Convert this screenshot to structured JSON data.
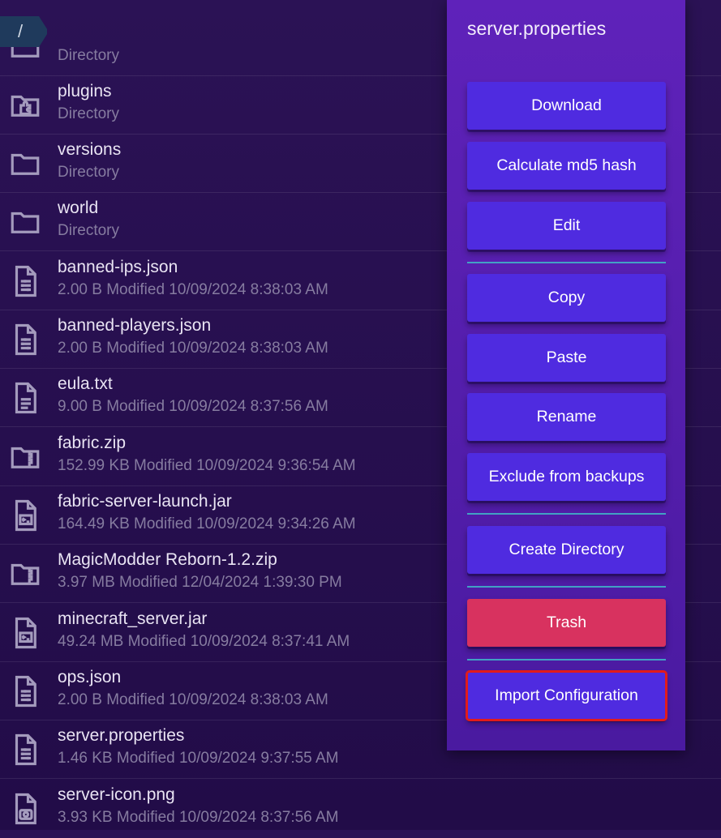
{
  "breadcrumb": {
    "path": "/"
  },
  "files": [
    {
      "name": "",
      "meta": "Directory",
      "icon": "folder-icon"
    },
    {
      "name": "plugins",
      "meta": "Directory",
      "icon": "plugin-folder-icon"
    },
    {
      "name": "versions",
      "meta": "Directory",
      "icon": "folder-icon"
    },
    {
      "name": "world",
      "meta": "Directory",
      "icon": "folder-icon"
    },
    {
      "name": "banned-ips.json",
      "meta": "2.00 B Modified 10/09/2024 8:38:03 AM",
      "icon": "config-file-icon"
    },
    {
      "name": "banned-players.json",
      "meta": "2.00 B Modified 10/09/2024 8:38:03 AM",
      "icon": "config-file-icon"
    },
    {
      "name": "eula.txt",
      "meta": "9.00 B Modified 10/09/2024 8:37:56 AM",
      "icon": "text-file-icon"
    },
    {
      "name": "fabric.zip",
      "meta": "152.99 KB Modified 10/09/2024 9:36:54 AM",
      "icon": "zip-folder-icon"
    },
    {
      "name": "fabric-server-launch.jar",
      "meta": "164.49 KB Modified 10/09/2024 9:34:26 AM",
      "icon": "executable-file-icon"
    },
    {
      "name": "MagicModder Reborn-1.2.zip",
      "meta": "3.97 MB Modified 12/04/2024 1:39:30 PM",
      "icon": "zip-folder-icon"
    },
    {
      "name": "minecraft_server.jar",
      "meta": "49.24 MB Modified 10/09/2024 8:37:41 AM",
      "icon": "executable-file-icon"
    },
    {
      "name": "ops.json",
      "meta": "2.00 B Modified 10/09/2024 8:38:03 AM",
      "icon": "config-file-icon"
    },
    {
      "name": "server.properties",
      "meta": "1.46 KB Modified 10/09/2024 9:37:55 AM",
      "icon": "config-file-icon"
    },
    {
      "name": "server-icon.png",
      "meta": "3.93 KB Modified 10/09/2024 8:37:56 AM",
      "icon": "image-file-icon"
    }
  ],
  "context_menu": {
    "title": "server.properties",
    "download": "Download",
    "md5": "Calculate md5 hash",
    "edit": "Edit",
    "copy": "Copy",
    "paste": "Paste",
    "rename": "Rename",
    "exclude": "Exclude from backups",
    "create_directory": "Create Directory",
    "trash": "Trash",
    "import_configuration": "Import Configuration"
  },
  "colors": {
    "accent_button": "#4f2be0",
    "danger_button": "#d8325f",
    "menu_background": "#5f22ba",
    "page_background": "#2b1255",
    "divider": "#3fb8c9",
    "highlight_outline": "#e21b1b"
  }
}
